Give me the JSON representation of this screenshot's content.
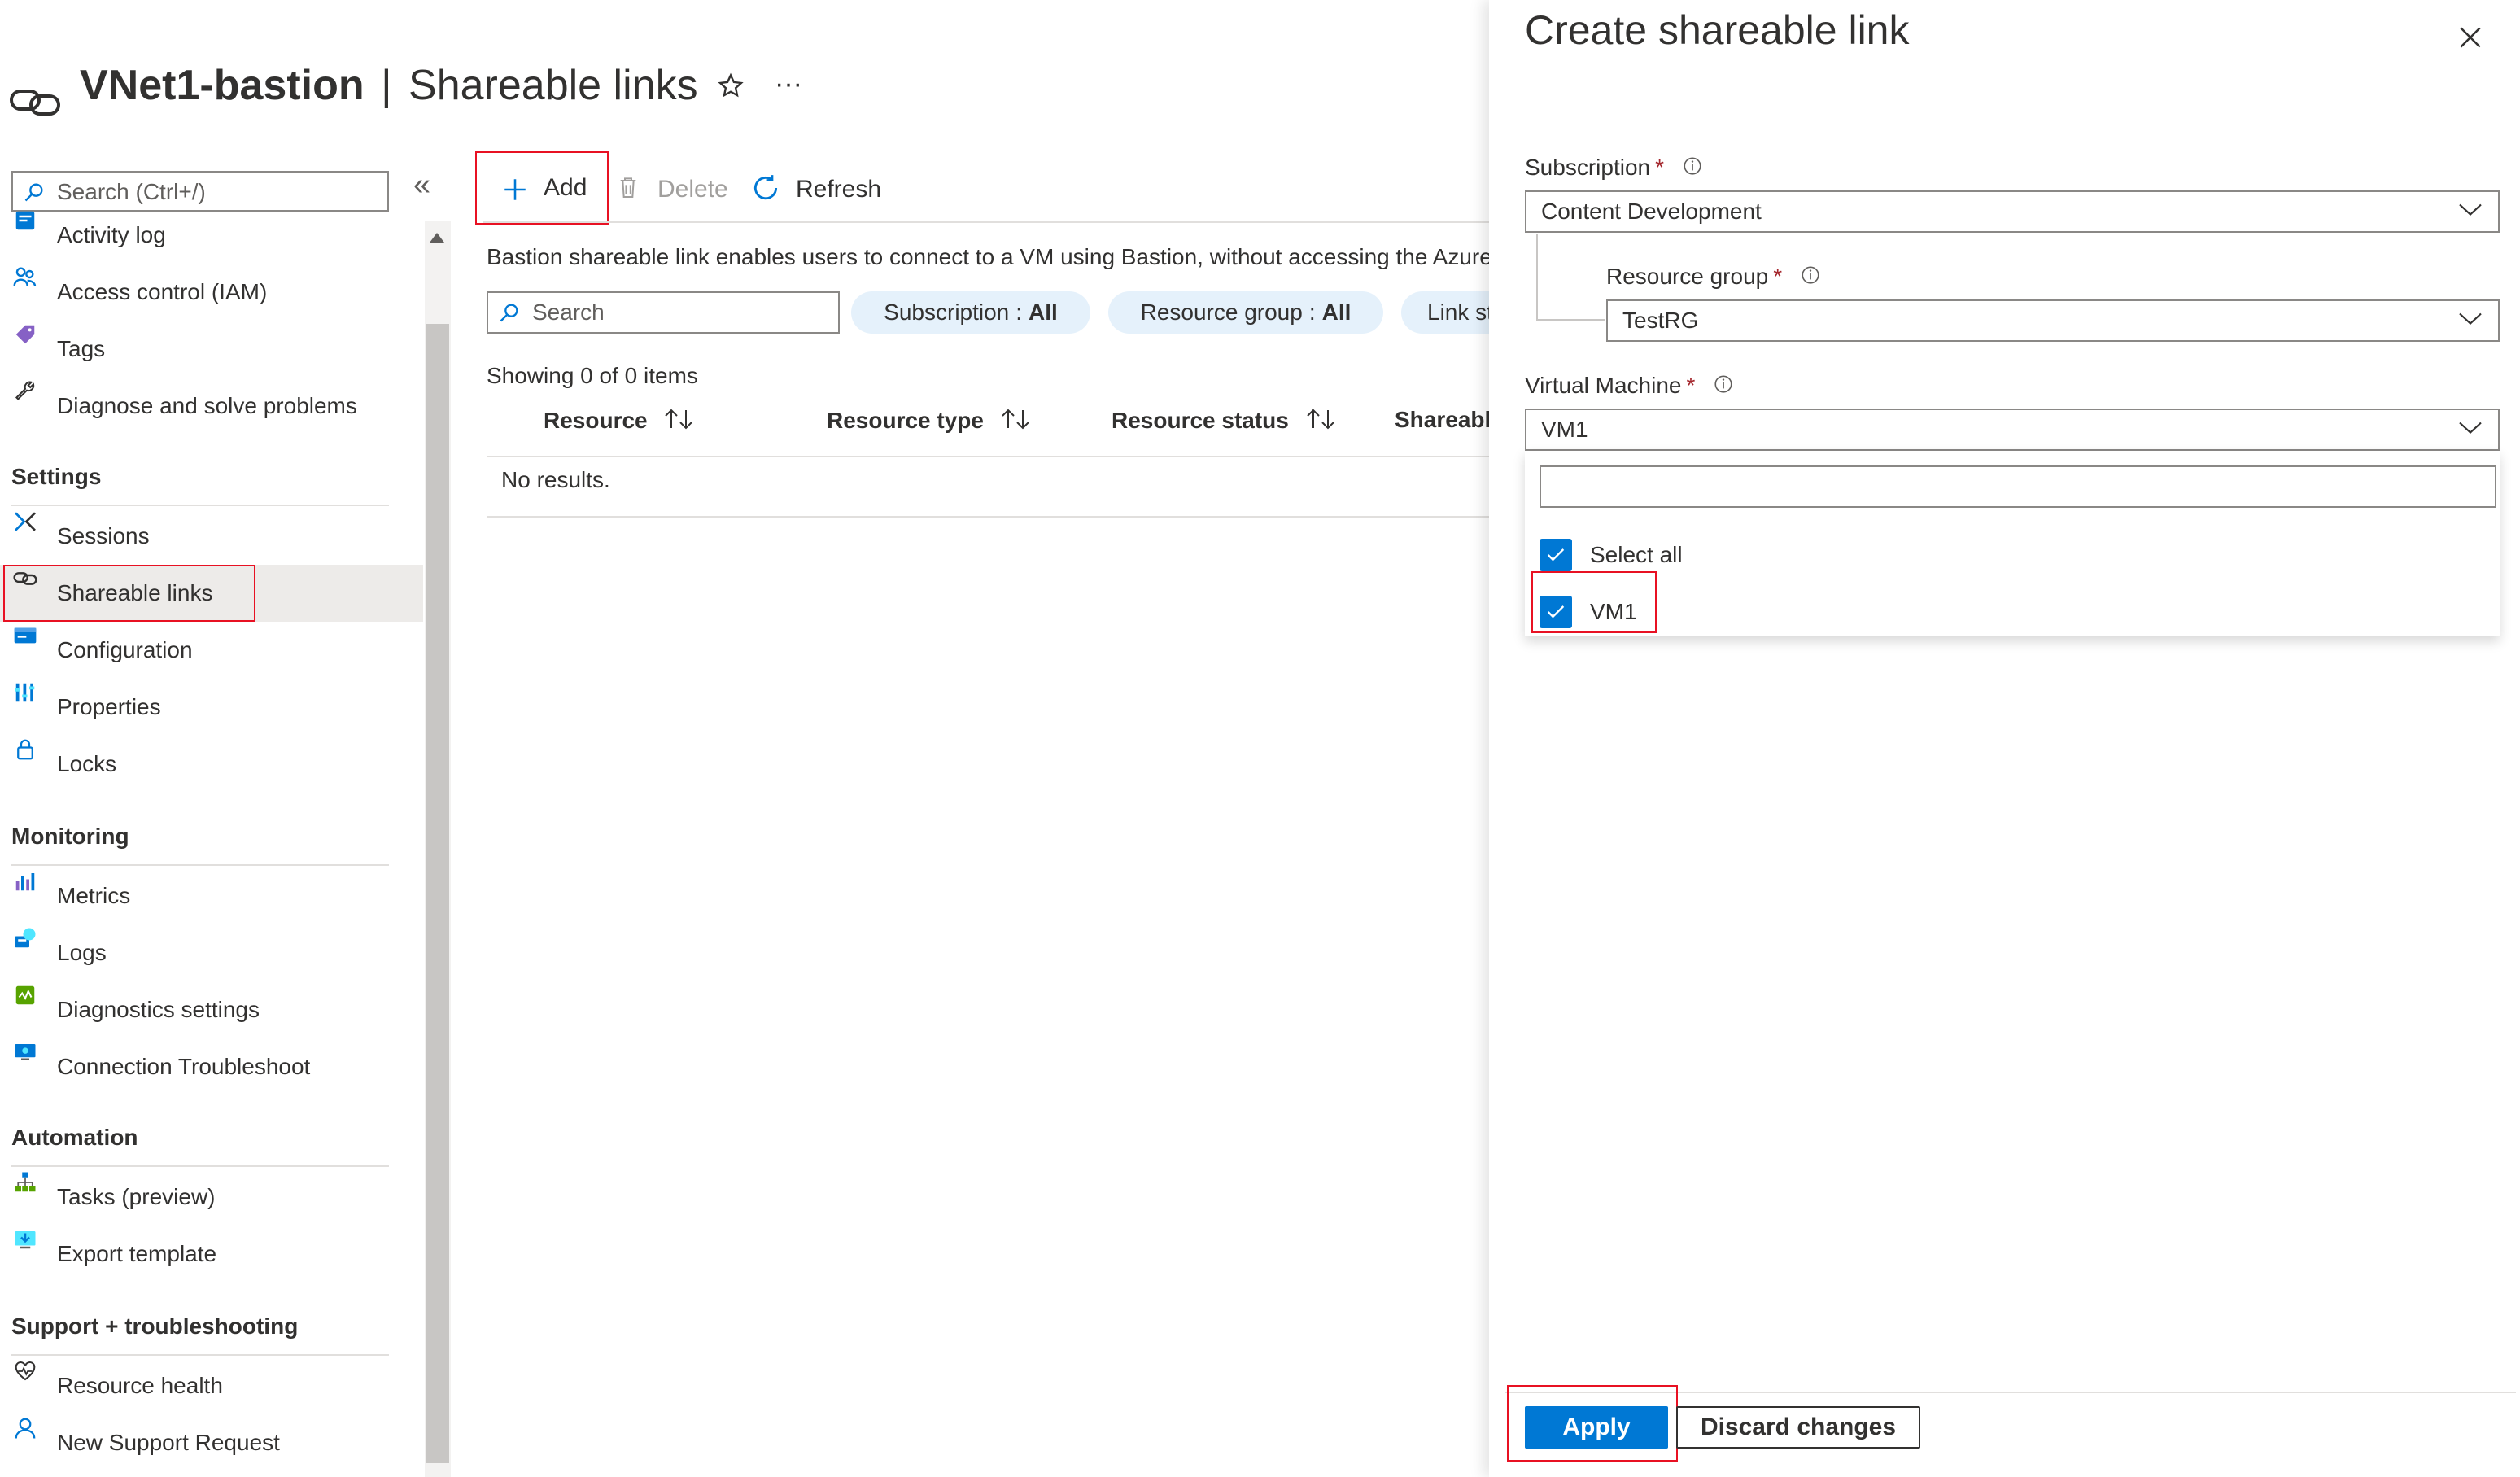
{
  "header": {
    "resource_name": "VNet1-bastion",
    "separator": "|",
    "page_name": "Shareable links",
    "favorite_icon": "star-icon",
    "more_icon": "ellipsis-icon",
    "more_label": "···"
  },
  "sidebar": {
    "search_placeholder": "Search (Ctrl+/)",
    "collapse_label": "«",
    "top_items": [
      {
        "label": "Activity log",
        "icon": "activity-log-icon"
      },
      {
        "label": "Access control (IAM)",
        "icon": "people-icon"
      },
      {
        "label": "Tags",
        "icon": "tag-icon"
      },
      {
        "label": "Diagnose and solve problems",
        "icon": "wrench-icon"
      }
    ],
    "sections": [
      {
        "title": "Settings",
        "items": [
          {
            "label": "Sessions",
            "icon": "sessions-icon"
          },
          {
            "label": "Shareable links",
            "icon": "link-icon",
            "selected": true
          },
          {
            "label": "Configuration",
            "icon": "configuration-icon"
          },
          {
            "label": "Properties",
            "icon": "properties-icon"
          },
          {
            "label": "Locks",
            "icon": "lock-icon"
          }
        ]
      },
      {
        "title": "Monitoring",
        "items": [
          {
            "label": "Metrics",
            "icon": "metrics-icon"
          },
          {
            "label": "Logs",
            "icon": "logs-icon"
          },
          {
            "label": "Diagnostics settings",
            "icon": "diagnostics-icon"
          },
          {
            "label": "Connection Troubleshoot",
            "icon": "monitor-icon"
          }
        ]
      },
      {
        "title": "Automation",
        "items": [
          {
            "label": "Tasks (preview)",
            "icon": "tasks-icon"
          },
          {
            "label": "Export template",
            "icon": "export-icon"
          }
        ]
      },
      {
        "title": "Support + troubleshooting",
        "items": [
          {
            "label": "Resource health",
            "icon": "heart-icon"
          },
          {
            "label": "New Support Request",
            "icon": "support-icon"
          }
        ]
      }
    ]
  },
  "toolbar": {
    "add_label": "Add",
    "delete_label": "Delete",
    "refresh_label": "Refresh"
  },
  "main": {
    "description": "Bastion shareable link enables users to connect to a VM using Bastion, without accessing the Azure portal.",
    "search_placeholder": "Search",
    "filters": [
      {
        "name": "Subscription",
        "value": "All"
      },
      {
        "name": "Resource group",
        "value": "All"
      },
      {
        "name": "Link status",
        "value": ""
      }
    ],
    "filter_separator": ":",
    "showing_text": "Showing 0 of 0 items",
    "columns": [
      "Resource",
      "Resource type",
      "Resource status",
      "Shareable link"
    ],
    "empty_text": "No results."
  },
  "panel": {
    "title": "Create shareable link",
    "close_icon": "close-icon",
    "required_mark": "*",
    "subscription": {
      "label": "Subscription",
      "value": "Content Development"
    },
    "resource_group": {
      "label": "Resource group",
      "value": "TestRG"
    },
    "virtual_machine": {
      "label": "Virtual Machine",
      "value": "VM1"
    },
    "vm_filter": {
      "value": ""
    },
    "vm_options": [
      {
        "label": "Select all",
        "checked": true
      },
      {
        "label": "VM1",
        "checked": true
      }
    ],
    "apply_label": "Apply",
    "discard_label": "Discard changes"
  },
  "colors": {
    "accent": "#0078d4",
    "highlight_box": "#e81123",
    "selected_bg": "#edebe9",
    "filter_pill_bg": "#e5f1fb"
  }
}
